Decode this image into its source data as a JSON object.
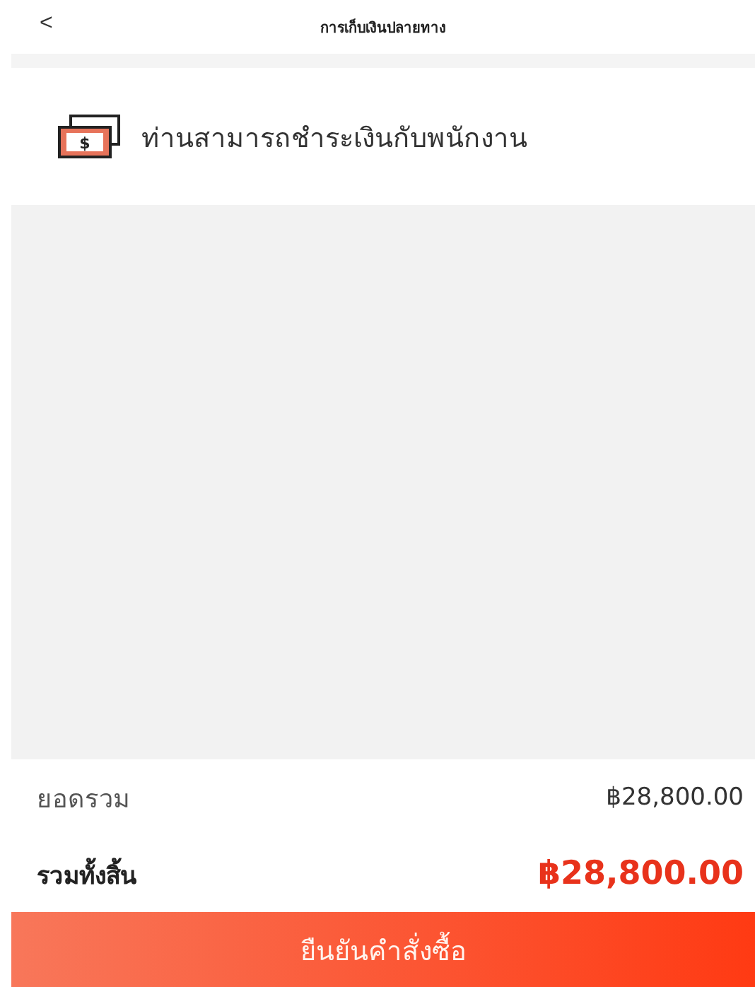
{
  "header": {
    "back": "<",
    "title": "การเก็บเงินปลายทาง"
  },
  "cash_icon_symbol": "$",
  "payment_note": "ท่านสามารถชำระเงินกับพนักงาน",
  "totals": [
    {
      "kind": "subtotal",
      "label": "ยอดรวม",
      "value": "฿28,800.00"
    },
    {
      "kind": "grand",
      "label": "รวมทั้งสิ้น",
      "value": "฿28,800.00"
    }
  ],
  "confirm_button": "ยืนยันคำสั่งซื้อ"
}
